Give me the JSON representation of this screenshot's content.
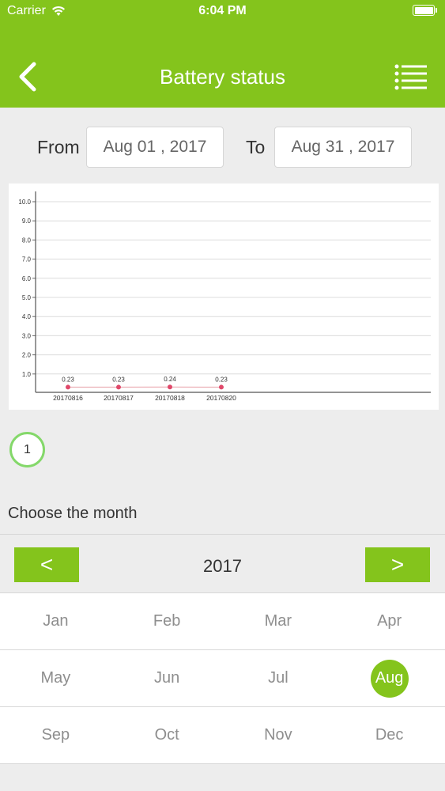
{
  "status_bar": {
    "carrier": "Carrier",
    "time": "6:04 PM"
  },
  "nav": {
    "title": "Battery status",
    "back_icon": "chevron-left-icon",
    "menu_icon": "list-menu-icon"
  },
  "range": {
    "from_label": "From",
    "from_value": "Aug 01 , 2017",
    "to_label": "To",
    "to_value": "Aug 31 , 2017"
  },
  "chart_data": {
    "type": "line",
    "categories": [
      "20170816",
      "20170817",
      "20170818",
      "20170820"
    ],
    "values": [
      0.23,
      0.23,
      0.24,
      0.23
    ],
    "data_labels": [
      "0.23",
      "0.23",
      "0.24",
      "0.23"
    ],
    "y_ticks": [
      "1.0",
      "2.0",
      "3.0",
      "4.0",
      "5.0",
      "6.0",
      "7.0",
      "8.0",
      "9.0",
      "10.0"
    ],
    "ylim": [
      0,
      10
    ],
    "grid": true,
    "line_color": "#e8a0a8",
    "point_color": "#e0486a"
  },
  "pager": {
    "current": "1"
  },
  "month_picker": {
    "label": "Choose the month",
    "year": "2017",
    "prev_label": "<",
    "next_label": ">",
    "months": [
      "Jan",
      "Feb",
      "Mar",
      "Apr",
      "May",
      "Jun",
      "Jul",
      "Aug",
      "Sep",
      "Oct",
      "Nov",
      "Dec"
    ],
    "selected": "Aug"
  },
  "colors": {
    "accent": "#84c41c",
    "pager_ring": "#84d86a"
  }
}
